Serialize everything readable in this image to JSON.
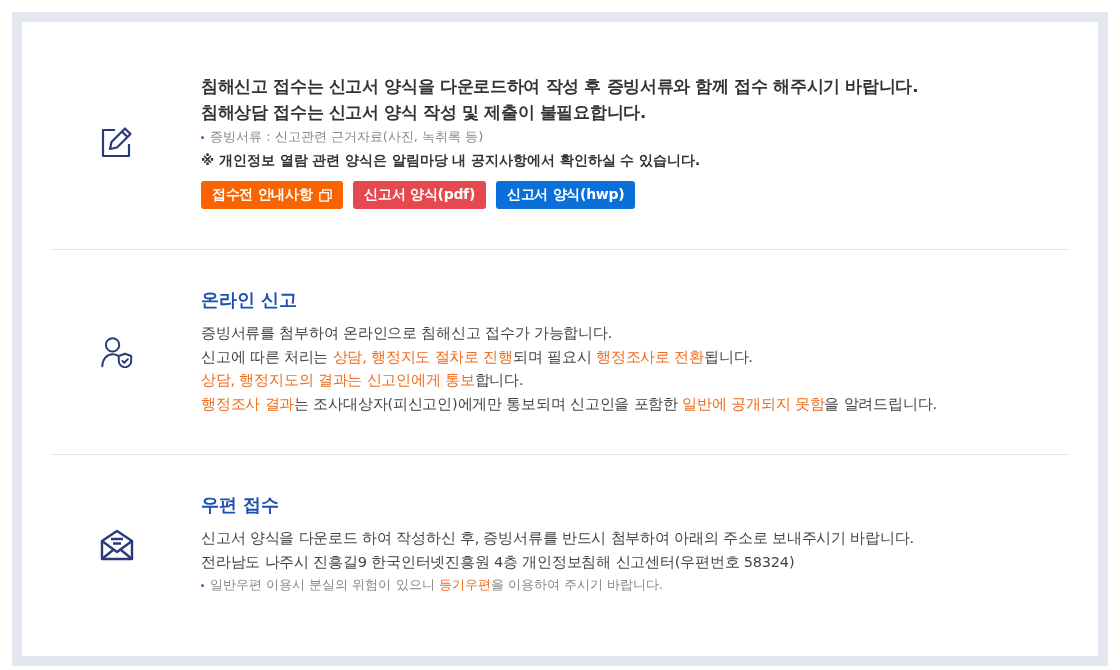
{
  "intro": {
    "headline": [
      "침해신고 접수는 신고서 양식을 다운로드하여 작성 후 증빙서류와 함께 접수 해주시기 바랍니다.",
      "침해상담 접수는 신고서 양식 작성 및 제출이 불필요합니다."
    ],
    "note": [
      {
        "text": "증빙서류 : 신고관련 근거자료(사진, 녹취록 등)",
        "emphasis": false
      }
    ],
    "privacy_note": "※ 개인정보 열람 관련 양식은 알림마당 내 공지사항에서 확인하실 수 있습니다.",
    "buttons": [
      {
        "label": "접수전 안내사항",
        "kind": "popup",
        "color": "#fa6400"
      },
      {
        "label": "신고서 양식(pdf)",
        "kind": "download",
        "color": "#e5484f"
      },
      {
        "label": "신고서 양식(hwp)",
        "kind": "download",
        "color": "#0a6fd8"
      }
    ]
  },
  "sections": [
    {
      "kind": "online",
      "title": "온라인 신고",
      "lines": [
        [
          {
            "text": "증빙서류를 첨부하여 온라인으로 침해신고 접수가 가능합니다.",
            "emphasis": false
          }
        ],
        [
          {
            "text": "신고에 따른 처리는 ",
            "emphasis": false
          },
          {
            "text": "상담, 행정지도 절차로 진행",
            "emphasis": true
          },
          {
            "text": "되며 필요시 ",
            "emphasis": false
          },
          {
            "text": "행정조사로 전환",
            "emphasis": true
          },
          {
            "text": "됩니다.",
            "emphasis": false
          }
        ],
        [
          {
            "text": "상담, 행정지도의 결과는 신고인에게 통보",
            "emphasis": true
          },
          {
            "text": "합니다.",
            "emphasis": false
          }
        ],
        [
          {
            "text": "행정조사 결과",
            "emphasis": true
          },
          {
            "text": "는 조사대상자(피신고인)에게만 통보되며 신고인을 포함한 ",
            "emphasis": false
          },
          {
            "text": "일반에 공개되지 못함",
            "emphasis": true
          },
          {
            "text": "을 알려드립니다.",
            "emphasis": false
          }
        ]
      ]
    },
    {
      "kind": "mail",
      "title": "우편 접수",
      "lines": [
        [
          {
            "text": "신고서 양식을 다운로드 하여 작성하신 후, 증빙서류를 반드시 첨부하여 아래의 주소로 보내주시기 바랍니다.",
            "emphasis": false
          }
        ],
        [
          {
            "text": "전라남도 나주시 진흥길9 한국인터넷진흥원 4층 개인정보침해 신고센터(우편번호 58324)",
            "emphasis": false
          }
        ]
      ],
      "note": [
        {
          "text": "일반우편 이용시 분실의 위험이 있으니 ",
          "emphasis": false
        },
        {
          "text": "등기우편",
          "emphasis": true
        },
        {
          "text": "을 이용하여 주시기 바랍니다.",
          "emphasis": false
        }
      ]
    }
  ]
}
